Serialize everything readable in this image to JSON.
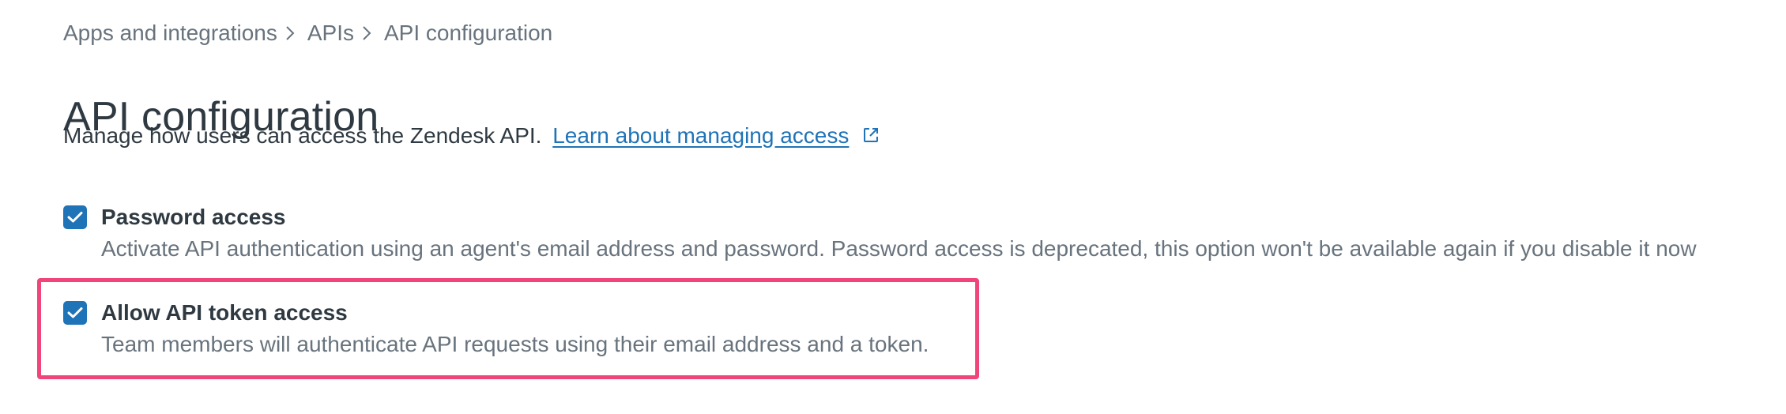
{
  "breadcrumb": {
    "items": [
      {
        "label": "Apps and integrations"
      },
      {
        "label": "APIs"
      },
      {
        "label": "API configuration"
      }
    ]
  },
  "page": {
    "title": "API configuration",
    "subtitle": "Manage how users can access the Zendesk API.",
    "learn_link": "Learn about managing access"
  },
  "options": [
    {
      "label": "Password access",
      "description": "Activate API authentication using an agent's email address and password. Password access is deprecated, this option won't be available again if you disable it now",
      "checked": true
    },
    {
      "label": "Allow API token access",
      "description": "Team members will authenticate API requests using their email address and a token.",
      "checked": true,
      "highlighted": true
    }
  ],
  "colors": {
    "accent": "#1f73b7",
    "highlight": "#f0457a",
    "text": "#2f3941",
    "muted": "#68737d"
  },
  "icons": {
    "breadcrumb_separator": "chevron-right-icon",
    "external_link": "external-link-icon",
    "checkbox_checked": "checkmark-icon"
  }
}
